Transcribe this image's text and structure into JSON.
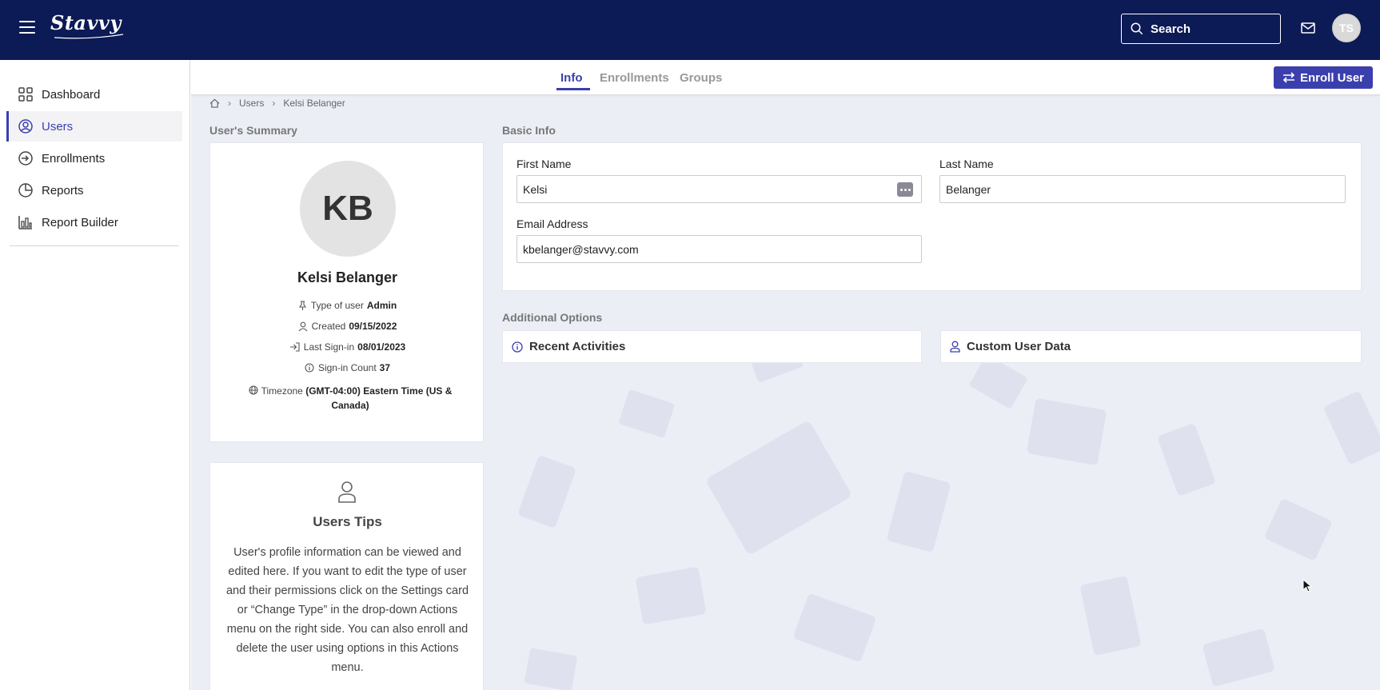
{
  "header": {
    "logo": "Stavvy",
    "search_label": "Search",
    "user_initials": "TS"
  },
  "sidebar": {
    "items": [
      {
        "label": "Dashboard",
        "icon": "grid-icon"
      },
      {
        "label": "Users",
        "icon": "user-circle-icon",
        "active": true
      },
      {
        "label": "Enrollments",
        "icon": "enter-icon"
      },
      {
        "label": "Reports",
        "icon": "pie-chart-icon"
      },
      {
        "label": "Report Builder",
        "icon": "bar-chart-icon"
      }
    ]
  },
  "tabs": [
    "Info",
    "Enrollments",
    "Groups"
  ],
  "active_tab": "Info",
  "enroll_button": "Enroll User",
  "breadcrumb": [
    "Users",
    "Kelsi Belanger"
  ],
  "summary": {
    "section_title": "User's Summary",
    "initials": "KB",
    "name": "Kelsi Belanger",
    "type_label": "Type of user",
    "type_value": "Admin",
    "created_label": "Created",
    "created_value": "09/15/2022",
    "last_signin_label": "Last Sign-in",
    "last_signin_value": "08/01/2023",
    "signin_count_label": "Sign-in Count",
    "signin_count_value": "37",
    "timezone_label": "Timezone",
    "timezone_value": "(GMT-04:00) Eastern Time (US & Canada)"
  },
  "tips": {
    "title": "Users Tips",
    "text": "User's profile information can be viewed and edited here. If you want to edit the type of user and their permissions click on the Settings card or “Change Type” in the drop-down Actions menu on the right side. You can also enroll and delete the user using options in this Actions menu."
  },
  "basic_info": {
    "section_title": "Basic Info",
    "first_name_label": "First Name",
    "first_name_value": "Kelsi",
    "last_name_label": "Last Name",
    "last_name_value": "Belanger",
    "email_label": "Email Address",
    "email_value": "kbelanger@stavvy.com"
  },
  "additional_options": {
    "section_title": "Additional Options",
    "items": [
      "Recent Activities",
      "Custom User Data"
    ]
  },
  "colors": {
    "topbar": "#0c1a55",
    "accent": "#3b3fae",
    "main_bg": "#eceef6"
  }
}
